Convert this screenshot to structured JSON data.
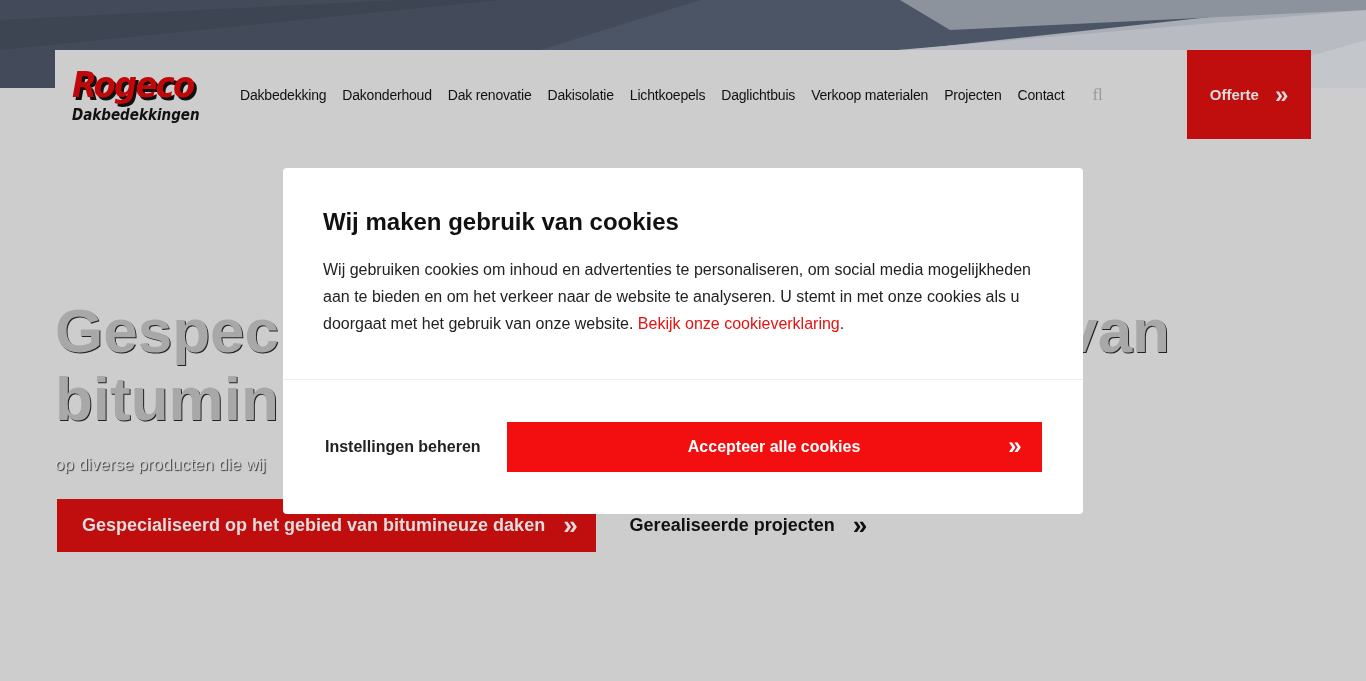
{
  "header": {
    "logo": {
      "name": "Rogeco",
      "tagline": "Dakbedekkingen"
    },
    "nav": [
      {
        "label": "Dakbedekking"
      },
      {
        "label": "Dakonderhoud"
      },
      {
        "label": "Dak renovatie"
      },
      {
        "label": "Dakisolatie"
      },
      {
        "label": "Lichtkoepels"
      },
      {
        "label": "Daglichtbuis"
      },
      {
        "label": "Verkoop materialen"
      },
      {
        "label": "Projecten"
      },
      {
        "label": "Contact"
      }
    ],
    "search_glyph": "fl",
    "cta": {
      "label": "Offerte",
      "chevron": "»"
    }
  },
  "hero": {
    "heading_fragments": [
      [
        "Gespec",
        "van"
      ],
      [
        "bitumin"
      ]
    ],
    "subtitle": "op diverse producten die wij",
    "buttons": [
      {
        "kind": "primary",
        "label": "Gespecialiseerd op het gebied van bitumineuze daken",
        "chevron": "»"
      },
      {
        "kind": "link",
        "label": "Gerealiseerde projecten",
        "chevron": "»"
      }
    ]
  },
  "cookie_dialog": {
    "title": "Wij maken gebruik van cookies",
    "text": "Wij gebruiken cookies om inhoud en advertenties te personaliseren, om social media mogelijkheden aan te bieden en om het verkeer naar de website te analyseren. U stemt in met onze cookies als u doorgaat met het gebruik van onze website.",
    "link": "Bekijk onze cookieverklaring",
    "after_link": ".",
    "settings_button": "Instellingen beheren",
    "accept_button": {
      "label": "Accepteer alle cookies",
      "chevron": "»"
    }
  }
}
